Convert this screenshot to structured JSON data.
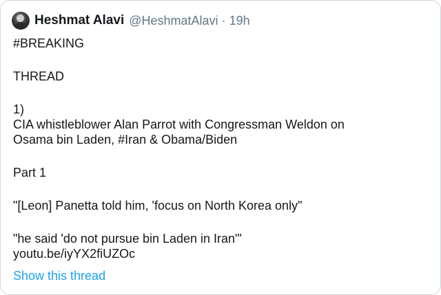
{
  "tweet": {
    "display_name": "Heshmat Alavi",
    "handle": "@HeshmatAlavi",
    "separator": "·",
    "time": "19h",
    "lines": [
      "#BREAKING",
      "",
      "THREAD",
      "",
      "1)",
      "CIA whistleblower Alan Parrot with Congressman Weldon on",
      "Osama bin Laden, #Iran & Obama/Biden",
      "",
      "Part 1",
      "",
      "\"[Leon] Panetta told him, 'focus on North Korea only\"",
      "",
      "\"he said 'do not pursue bin Laden in Iran'\"",
      "youtu.be/iyYX2fiUZOc"
    ],
    "show_thread": "Show this thread"
  }
}
